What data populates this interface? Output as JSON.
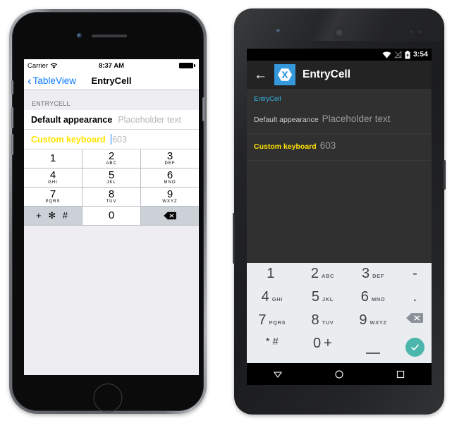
{
  "ios": {
    "status": {
      "carrier": "Carrier",
      "wifi_icon": "wifi-icon",
      "time": "8:37 AM",
      "battery_icon": "battery-full-icon"
    },
    "navbar": {
      "back_chevron": "‹",
      "back_label": "TableView",
      "title": "EntryCell"
    },
    "section_header": "ENTRYCELL",
    "cells": [
      {
        "label": "Default appearance",
        "value": "Placeholder text",
        "caret": false
      },
      {
        "label": "Custom keyboard",
        "value": "603",
        "caret": true
      }
    ],
    "keyboard": {
      "rows": [
        [
          {
            "num": "1",
            "sub": ""
          },
          {
            "num": "2",
            "sub": "ABC"
          },
          {
            "num": "3",
            "sub": "DEF"
          }
        ],
        [
          {
            "num": "4",
            "sub": "GHI"
          },
          {
            "num": "5",
            "sub": "JKL"
          },
          {
            "num": "6",
            "sub": "MNO"
          }
        ],
        [
          {
            "num": "7",
            "sub": "PQRS"
          },
          {
            "num": "8",
            "sub": "TUV"
          },
          {
            "num": "9",
            "sub": "WXYZ"
          }
        ]
      ],
      "symbol_key": "+ ✻ #",
      "zero_key": "0",
      "delete_key": "delete-icon"
    }
  },
  "android": {
    "status": {
      "wifi_icon": "wifi-icon",
      "signal_icon": "signal-off-icon",
      "battery_icon": "battery-charging-icon",
      "time": "3:54"
    },
    "toolbar": {
      "back_arrow": "←",
      "logo": "xamarin-logo",
      "title": "EntryCell"
    },
    "section_header": "EntryCell",
    "rows": [
      {
        "label": "Default appearance",
        "value": "Placeholder text",
        "underline": "grey"
      },
      {
        "label": "Custom keyboard",
        "value": "603",
        "underline": "teal"
      }
    ],
    "keyboard": {
      "rows": [
        [
          {
            "num": "1",
            "sub": ""
          },
          {
            "num": "2",
            "sub": "ABC"
          },
          {
            "num": "3",
            "sub": "DEF"
          },
          {
            "num": "-",
            "sub": ""
          }
        ],
        [
          {
            "num": "4",
            "sub": "GHI"
          },
          {
            "num": "5",
            "sub": "JKL"
          },
          {
            "num": "6",
            "sub": "MNO"
          },
          {
            "num": ".",
            "sub": ""
          }
        ],
        [
          {
            "num": "7",
            "sub": "PQRS"
          },
          {
            "num": "8",
            "sub": "TUV"
          },
          {
            "num": "9",
            "sub": "WXYZ"
          },
          {
            "num": "delete-icon",
            "sub": ""
          }
        ]
      ],
      "star_key": "*",
      "hash_key": "#",
      "zero_key": "0",
      "plus_key": "+",
      "space_key": "space-icon",
      "ok_key": "check-icon"
    },
    "nav": {
      "back": "back-triangle-icon",
      "home": "home-circle-icon",
      "recents": "recents-square-icon"
    }
  },
  "colors": {
    "ios_blue": "#0a7cff",
    "yellow": "#ffe400",
    "android_blue": "#33b5e5",
    "xamarin_blue": "#3498db",
    "teal": "#4db6ac"
  }
}
